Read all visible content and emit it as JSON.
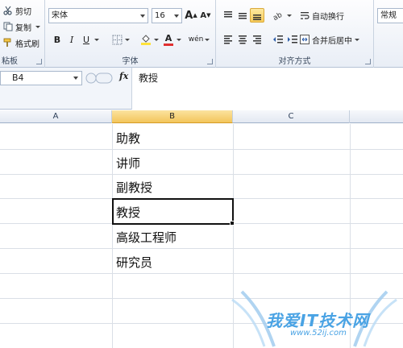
{
  "clipboard": {
    "cut": "剪切",
    "copy": "复制",
    "format_painter": "格式刷",
    "group_label": "粘板"
  },
  "font": {
    "name": "宋体",
    "size": "16",
    "group_label": "字体",
    "bold": "B",
    "italic": "I",
    "underline": "U",
    "grow": "A",
    "shrink": "A",
    "font_color_letter": "A",
    "phonetic": "wén"
  },
  "alignment": {
    "wrap_text": "自动换行",
    "merge_center": "合并后居中",
    "group_label": "对齐方式"
  },
  "number": {
    "format": "常规"
  },
  "formula_bar": {
    "name_box": "B4",
    "fx": "fx",
    "content": "教授"
  },
  "columns": [
    "A",
    "B",
    "C"
  ],
  "cells": [
    {
      "ref": "B1",
      "value": "助教"
    },
    {
      "ref": "B2",
      "value": "讲师"
    },
    {
      "ref": "B3",
      "value": "副教授"
    },
    {
      "ref": "B4",
      "value": "教授"
    },
    {
      "ref": "B5",
      "value": "高级工程师"
    },
    {
      "ref": "B6",
      "value": "研究员"
    }
  ],
  "watermark": {
    "brand": "我爱IT技术网",
    "url": "www.52ij.com"
  },
  "colors": {
    "active_header": "#f3c55b",
    "font_color": "#e03030",
    "fill_color": "#ffe23a",
    "watermark": "#4aa3e4"
  }
}
